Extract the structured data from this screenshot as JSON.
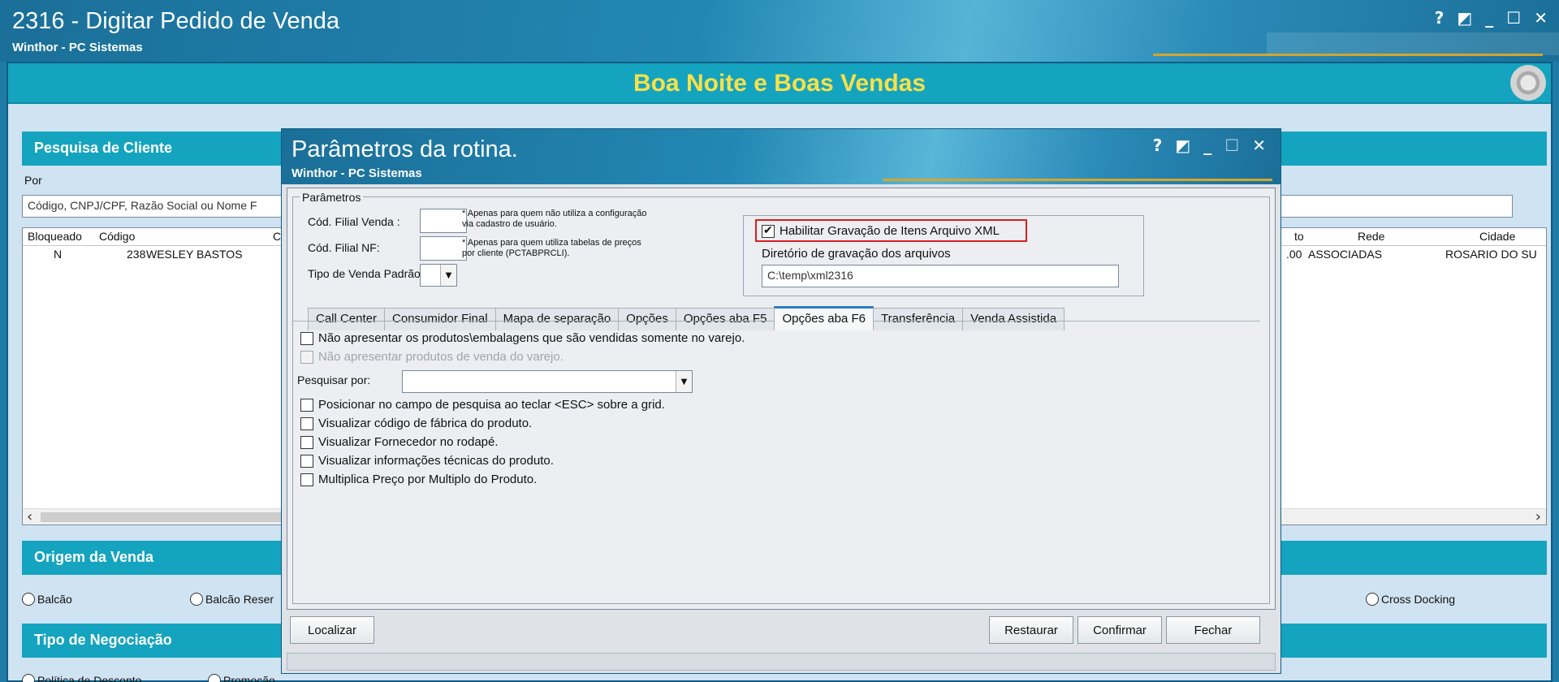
{
  "window": {
    "title": "2316 - Digitar Pedido de Venda",
    "subtitle": "Winthor - PC Sistemas",
    "controls": [
      "?",
      "◩",
      "_",
      "☐",
      "✕"
    ]
  },
  "banner": {
    "text": "Boa Noite e Boas Vendas"
  },
  "cliente": {
    "section_title": "Pesquisa de Cliente",
    "por_label": "Por",
    "search_value": "Código, CNPJ/CPF, Razão Social ou Nome F",
    "grid": {
      "columns": [
        "Bloqueado",
        "Código",
        "C",
        "to",
        "Rede",
        "Cidade"
      ],
      "rows": [
        {
          "bloqueado": "N",
          "codigo": "238",
          "cliente": "WESLEY BASTOS",
          "to": ".00",
          "rede": "ASSOCIADAS",
          "cidade": "ROSARIO DO SU"
        }
      ]
    }
  },
  "origem": {
    "section_title": "Origem da Venda",
    "options": [
      "Balcão",
      "Balcão Reser",
      "Cross Docking"
    ]
  },
  "negociacao": {
    "section_title": "Tipo de Negociação",
    "options": [
      "Política de Desconto",
      "Promoção"
    ]
  },
  "dialog": {
    "title": "Parâmetros da rotina.",
    "subtitle": "Winthor - PC Sistemas",
    "controls": [
      "?",
      "◩",
      "_",
      "☐",
      "✕"
    ],
    "group_label": "Parâmetros",
    "fields": {
      "cod_filial_venda_label": "Cód. Filial Venda :",
      "cod_filial_venda_note": "* Apenas para quem não utiliza a configuração via cadastro de usuário.",
      "cod_filial_nf_label": "Cód. Filial NF:",
      "cod_filial_nf_note": "* Apenas para quem utiliza tabelas de preços por cliente (PCTABPRCLI).",
      "tipo_venda_label": "Tipo de Venda Padrão:"
    },
    "xml": {
      "checkbox_label": "Habilitar Gravação de Itens Arquivo XML",
      "checked": true,
      "dir_label": "Diretório de gravação dos arquivos",
      "dir_value": "C:\\temp\\xml2316"
    },
    "tabs": [
      "Call Center",
      "Consumidor Final",
      "Mapa de separação",
      "Opções",
      "Opções aba F5",
      "Opções aba F6",
      "Transferência",
      "Venda Assistida"
    ],
    "active_tab": "Opções aba F6",
    "tab_content": {
      "option1": "Não apresentar os produtos\\embalagens que são vendidas somente no varejo.",
      "option2": "Não apresentar produtos de venda do varejo.",
      "pesquisar_label": "Pesquisar por:",
      "pesquisar_value": "",
      "option3": "Posicionar no campo de pesquisa ao teclar <ESC> sobre a grid.",
      "option4": "Visualizar código de fábrica do produto.",
      "option5": "Visualizar Fornecedor no rodapé.",
      "option6": "Visualizar informações técnicas do produto.",
      "option7": "Multiplica Preço por Multiplo do Produto."
    },
    "buttons": {
      "localizar": "Localizar",
      "restaurar": "Restaurar",
      "confirmar": "Confirmar",
      "fechar": "Fechar"
    }
  }
}
